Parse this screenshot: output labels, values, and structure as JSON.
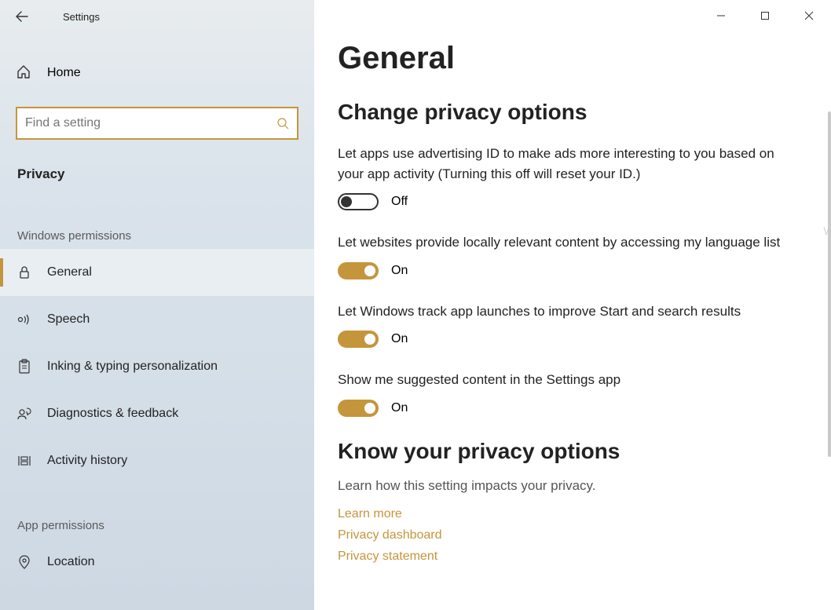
{
  "window": {
    "title": "Settings"
  },
  "sidebar": {
    "home": "Home",
    "search_placeholder": "Find a setting",
    "category": "Privacy",
    "section1": "Windows permissions",
    "section2": "App permissions",
    "items": {
      "general": "General",
      "speech": "Speech",
      "inking": "Inking & typing personalization",
      "diagnostics": "Diagnostics & feedback",
      "activity": "Activity history",
      "location": "Location"
    }
  },
  "main": {
    "title": "General",
    "section1_title": "Change privacy options",
    "settings": [
      {
        "desc": "Let apps use advertising ID to make ads more interesting to you based on your app activity (Turning this off will reset your ID.)",
        "state": "Off"
      },
      {
        "desc": "Let websites provide locally relevant content by accessing my language list",
        "state": "On"
      },
      {
        "desc": "Let Windows track app launches to improve Start and search results",
        "state": "On"
      },
      {
        "desc": "Show me suggested content in the Settings app",
        "state": "On"
      }
    ],
    "section2_title": "Know your privacy options",
    "section2_desc": "Learn how this setting impacts your privacy.",
    "links": {
      "learn": "Learn more",
      "dashboard": "Privacy dashboard",
      "statement": "Privacy statement"
    }
  },
  "watermark": "Windo"
}
